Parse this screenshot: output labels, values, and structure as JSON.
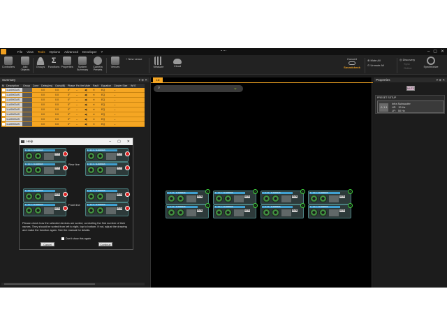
{
  "menu": [
    "File",
    "View",
    "Tools",
    "Options",
    "Advanced",
    "Developer",
    "?"
  ],
  "menu_active": "Tools",
  "window_controls": [
    "–",
    "▢",
    "✕"
  ],
  "ribbon": {
    "controllers": "Controllers",
    "add_objects": "Add\nObjects",
    "groups": "Groups",
    "functions": "Functions",
    "properties": "Properties",
    "system_summary": "System\nSummary",
    "camera_presets": "Camera\nPresets",
    "venues": "Venues",
    "new_venue": "New venue",
    "measure": "Measure",
    "cloud": "Cloud",
    "concert": "Concert",
    "soundcheck": "Soundcheck",
    "mute_all": "Mute All",
    "unmute_all": "Unmute All",
    "discovery": "Discovery",
    "sync": "Sync",
    "online": "Online",
    "synchronize": "Synchronize"
  },
  "summary": {
    "title": "Summary",
    "columns": [
      "M",
      "Description",
      "Group",
      "Zone",
      "Delay(ms)",
      "Gain(dB)",
      "Phase",
      "Fw Ver",
      "Mute",
      "Fault",
      "Equation",
      "Cluster Size",
      "Wf E"
    ],
    "rows": [
      {
        "desc": "1LA9000AS",
        "delay": "0.0",
        "gain": "0.0",
        "phase": "0°",
        "fw": "--",
        "eq": "EQ"
      },
      {
        "desc": "1LA9000AS",
        "delay": "0.0",
        "gain": "0.0",
        "phase": "0°",
        "fw": "--",
        "eq": "EQ"
      },
      {
        "desc": "1LA9000AS",
        "delay": "0.0",
        "gain": "0.0",
        "phase": "0°",
        "fw": "--",
        "eq": "EQ"
      },
      {
        "desc": "1LA9000AS",
        "delay": "0.0",
        "gain": "0.0",
        "phase": "0°",
        "fw": "--",
        "eq": "EQ"
      },
      {
        "desc": "1LA9000AS",
        "delay": "0.0",
        "gain": "0.0",
        "phase": "0°",
        "fw": "--",
        "eq": "EQ"
      },
      {
        "desc": "1LA9000AS",
        "delay": "0.0",
        "gain": "0.0",
        "phase": "0°",
        "fw": "--",
        "eq": "EQ"
      },
      {
        "desc": "1LA9000AS",
        "delay": "0.0",
        "gain": "0.0",
        "phase": "0°",
        "fw": "--",
        "eq": "EQ"
      },
      {
        "desc": "1LA9000AS",
        "delay": "0.0",
        "gain": "0.0",
        "phase": "0°",
        "fw": "--",
        "eq": "EQ"
      }
    ]
  },
  "canvas": {
    "tab": "1D"
  },
  "amp": {
    "label": "1 - 1.1.1 - 1LA9000AS",
    "mute": "MUTE"
  },
  "properties": {
    "title": "Properties",
    "mute": "MUTE",
    "preset_title": "PRESET SETUP",
    "preset_icon_text": "1.1",
    "preset_name": "Infra Subwoofer",
    "preset_hp": "HP:",
    "preset_hp_val": "30 Hz",
    "preset_lp": "LP:",
    "preset_lp_val": "50 Hz"
  },
  "help": {
    "title": "Help",
    "rear_line": "Rear line",
    "front_line": "Front line",
    "text": "Please check how the selected devices are sorted, controlling the first number of their names. They should be sorted from left to right, top to bottom. If not, adjust the drawing and make the function again. See the manual for details.",
    "dont_show": "Don't show this again",
    "cancel": "Cancel",
    "continue": "Continue"
  },
  "colors": {
    "accent": "#f5a623",
    "ok": "#3fd03f",
    "fault": "#dd2222",
    "amp_header": "#40a0d0"
  }
}
